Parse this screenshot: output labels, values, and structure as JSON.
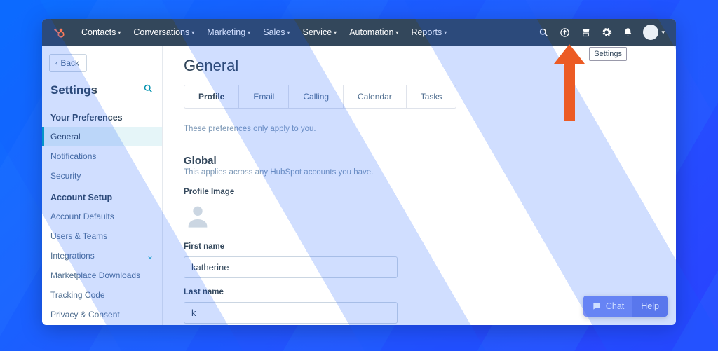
{
  "topbar": {
    "nav": [
      "Contacts",
      "Conversations",
      "Marketing",
      "Sales",
      "Service",
      "Automation",
      "Reports"
    ],
    "tooltip": "Settings"
  },
  "sidebar": {
    "back": "Back",
    "title": "Settings",
    "group1_title": "Your Preferences",
    "group1_items": [
      "General",
      "Notifications",
      "Security"
    ],
    "group2_title": "Account Setup",
    "group2_items": [
      "Account Defaults",
      "Users & Teams",
      "Integrations",
      "Marketplace Downloads",
      "Tracking Code",
      "Privacy & Consent"
    ]
  },
  "main": {
    "title": "General",
    "tabs": [
      "Profile",
      "Email",
      "Calling",
      "Calendar",
      "Tasks"
    ],
    "note": "These preferences only apply to you.",
    "global_h": "Global",
    "global_sub": "This applies across any HubSpot accounts you have.",
    "profile_image_label": "Profile Image",
    "first_name_label": "First name",
    "first_name_value": "katherine",
    "last_name_label": "Last name",
    "last_name_value": "k"
  },
  "footer": {
    "chat": "Chat",
    "help": "Help"
  }
}
